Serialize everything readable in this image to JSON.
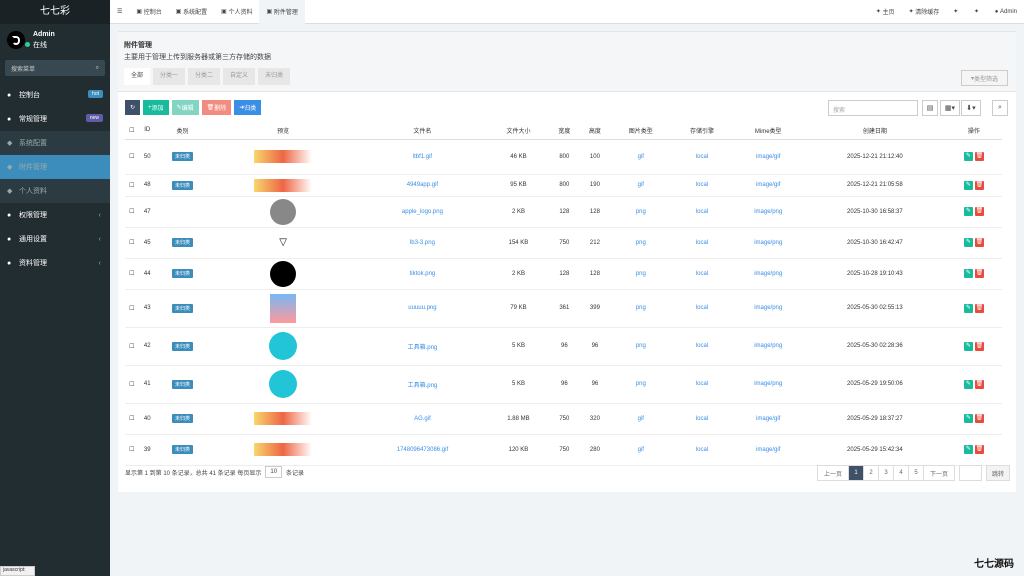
{
  "app": {
    "name": "七七彩",
    "user": "Admin",
    "online": "在线",
    "search_placeholder": "搜索菜单"
  },
  "nav": [
    {
      "label": "控制台",
      "icon": "dashboard-icon",
      "badge": "hot",
      "badge_color": "#3c8dbc"
    },
    {
      "label": "常规管理",
      "icon": "cogs-icon",
      "badge": "new",
      "badge_color": "#605ca8",
      "open": true
    },
    {
      "label": "系统配置",
      "icon": "cog-icon",
      "sub": true
    },
    {
      "label": "附件管理",
      "icon": "file-image-icon",
      "sub": true,
      "active": true
    },
    {
      "label": "个人资料",
      "icon": "user-icon",
      "sub": true
    },
    {
      "label": "权限管理",
      "icon": "group-icon",
      "caret": true
    },
    {
      "label": "通用设置",
      "icon": "list-icon",
      "caret": true
    },
    {
      "label": "资料管理",
      "icon": "list-icon",
      "caret": true
    }
  ],
  "top": {
    "menu_icon": "menu-icon",
    "tabs": [
      {
        "label": "控制台",
        "icon": "dashboard-icon"
      },
      {
        "label": "系统配置",
        "icon": "cog-icon"
      },
      {
        "label": "个人资料",
        "icon": "user-icon"
      },
      {
        "label": "附件管理",
        "icon": "file-image-icon",
        "active": true
      }
    ],
    "right": [
      {
        "label": "主页",
        "icon": "home-icon"
      },
      {
        "label": "清除缓存",
        "icon": "trash-icon"
      },
      {
        "label": "",
        "icon": "theme-icon"
      },
      {
        "label": "",
        "icon": "fullscreen-icon"
      },
      {
        "label": "Admin",
        "icon": "avatar-icon"
      }
    ]
  },
  "page": {
    "title": "附件管理",
    "desc": "主要用于管理上传到服务器或第三方存储的数据",
    "filter_tabs": [
      "全部",
      "分类一",
      "分类二",
      "自定义",
      "未归类"
    ],
    "type_filter": "类型筛选"
  },
  "toolbar": [
    "刷新",
    "添加",
    "编辑",
    "删除",
    "归类"
  ],
  "table_search": "搜索",
  "columns": [
    "",
    "ID",
    "类别",
    "预览",
    "文件名",
    "文件大小",
    "宽度",
    "高度",
    "图片类型",
    "存储引擎",
    "Mime类型",
    "创建日期",
    "操作"
  ],
  "rows": [
    {
      "id": "50",
      "cat": "未归类",
      "preview": "banner",
      "name": "ltbf1.gif",
      "size": "46 KB",
      "w": "800",
      "h": "100",
      "type": "gif",
      "engine": "local",
      "mime": "image/gif",
      "date": "2025-12-21 21:12:40"
    },
    {
      "id": "48",
      "cat": "未归类",
      "preview": "banner",
      "name": "4949app.gif",
      "size": "95 KB",
      "w": "800",
      "h": "190",
      "type": "gif",
      "engine": "local",
      "mime": "image/gif",
      "date": "2025-12-21 21:05:58"
    },
    {
      "id": "47",
      "cat": "",
      "preview": "apple",
      "name": "apple_logo.png",
      "size": "2 KB",
      "w": "128",
      "h": "128",
      "type": "png",
      "engine": "local",
      "mime": "image/png",
      "date": "2025-10-30 16:58:37"
    },
    {
      "id": "45",
      "cat": "未归类",
      "preview": "logo",
      "name": "lb3-3.png",
      "size": "154 KB",
      "w": "750",
      "h": "212",
      "type": "png",
      "engine": "local",
      "mime": "image/png",
      "date": "2025-10-30 16:42:47"
    },
    {
      "id": "44",
      "cat": "未归类",
      "preview": "tiktok",
      "name": "tiktok.png",
      "size": "2 KB",
      "w": "128",
      "h": "128",
      "type": "png",
      "engine": "local",
      "mime": "image/png",
      "date": "2025-10-28 19:10:43"
    },
    {
      "id": "43",
      "cat": "未归类",
      "preview": "poster",
      "name": "uuuuu.png",
      "size": "79 KB",
      "w": "361",
      "h": "399",
      "type": "png",
      "engine": "local",
      "mime": "image/png",
      "date": "2025-05-30 02:55:13"
    },
    {
      "id": "42",
      "cat": "未归类",
      "preview": "toolbox",
      "name": "工具箱.png",
      "size": "5 KB",
      "w": "96",
      "h": "96",
      "type": "png",
      "engine": "local",
      "mime": "image/png",
      "date": "2025-05-30 02:28:36"
    },
    {
      "id": "41",
      "cat": "未归类",
      "preview": "toolbox",
      "name": "工具箱.png",
      "size": "5 KB",
      "w": "96",
      "h": "96",
      "type": "png",
      "engine": "local",
      "mime": "image/png",
      "date": "2025-05-29 19:50:06"
    },
    {
      "id": "40",
      "cat": "未归类",
      "preview": "banner",
      "name": "AG.gif",
      "size": "1.88 MB",
      "w": "750",
      "h": "320",
      "type": "gif",
      "engine": "local",
      "mime": "image/gif",
      "date": "2025-05-29 18:37:27"
    },
    {
      "id": "39",
      "cat": "未归类",
      "preview": "banner",
      "name": "1748096473086.gif",
      "size": "120 KB",
      "w": "750",
      "h": "280",
      "type": "gif",
      "engine": "local",
      "mime": "image/gif",
      "date": "2025-05-29 15:42:34"
    }
  ],
  "footer": {
    "summary": "显示第 1 到第 10 条记录，总共 41 条记录 每页显示",
    "per_page": "10",
    "suffix": "条记录"
  },
  "pagination": {
    "prev": "上一页",
    "pages": [
      "1",
      "2",
      "3",
      "4",
      "5"
    ],
    "next": "下一页",
    "jump": "跳转"
  },
  "status": "javascript:",
  "watermark": "七七源码"
}
